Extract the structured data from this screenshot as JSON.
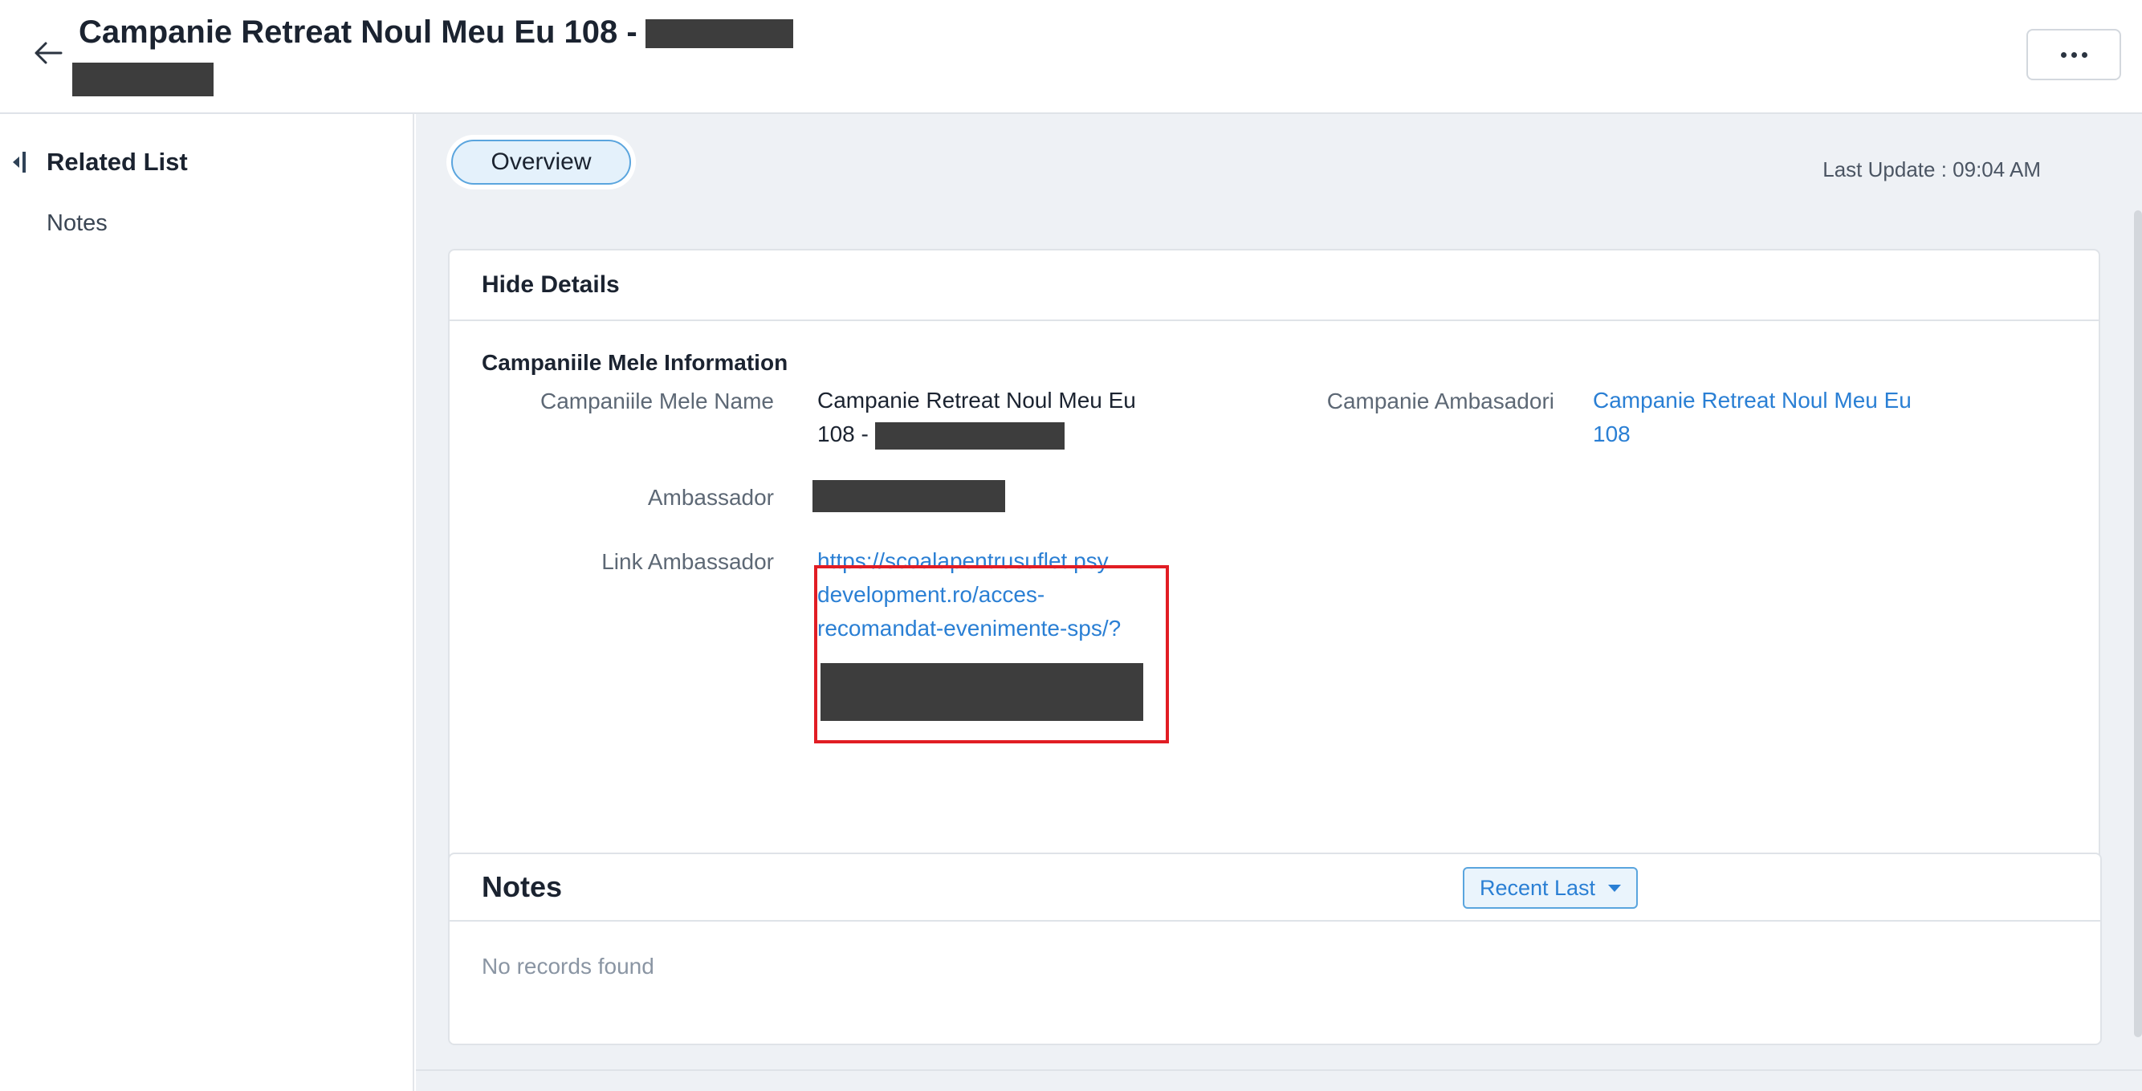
{
  "header": {
    "title": "Campanie Retreat Noul Meu Eu 108 -"
  },
  "sidebar": {
    "title": "Related List",
    "items": [
      {
        "label": "Notes"
      }
    ]
  },
  "main": {
    "tabs": [
      {
        "label": "Overview"
      }
    ],
    "last_update": "Last Update : 09:04 AM"
  },
  "details": {
    "toggle_label": "Hide Details",
    "section_title": "Campaniile Mele Information",
    "fields": {
      "name": {
        "label": "Campaniile Mele Name",
        "value_line1": "Campanie Retreat Noul Meu Eu",
        "value_line2": "108 -"
      },
      "ambasadori": {
        "label": "Campanie Ambasadori",
        "value_line1": "Campanie Retreat Noul Meu Eu",
        "value_line2": "108"
      },
      "ambassador": {
        "label": "Ambassador"
      },
      "link": {
        "label": "Link Ambassador",
        "line1": "https://scoalapentrusuflet.psy",
        "line2": "development.ro/acces-",
        "line3": "recomandat-evenimente-sps/?"
      }
    }
  },
  "notes": {
    "title": "Notes",
    "sort_label": "Recent Last",
    "empty_text": "No records found"
  }
}
